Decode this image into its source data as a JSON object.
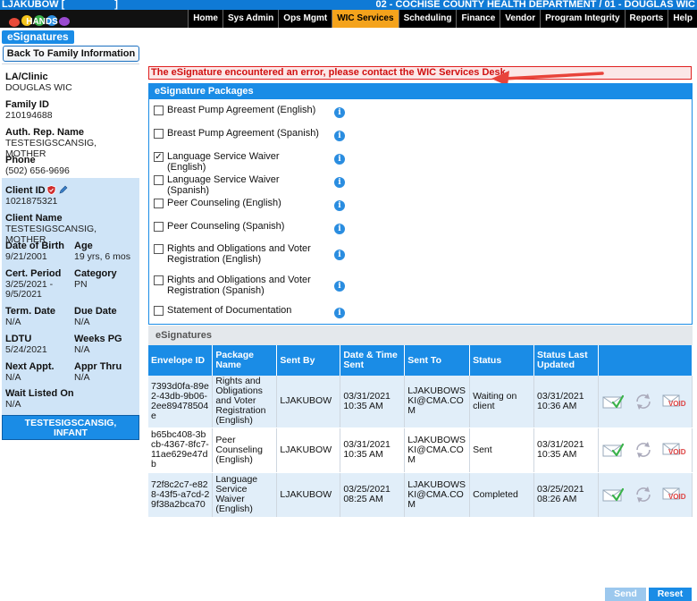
{
  "header": {
    "user": "LJAKUBOW [",
    "user_bracket_close": "]",
    "agency": "02 - COCHISE COUNTY HEALTH DEPARTMENT / 01 - DOUGLAS WIC",
    "logo_text": "HANDS"
  },
  "nav": {
    "tabs": [
      "Home",
      "Sys Admin",
      "Ops Mgmt",
      "WIC Services",
      "Scheduling",
      "Finance",
      "Vendor",
      "Program Integrity",
      "Reports",
      "Help"
    ],
    "active": "WIC Services"
  },
  "page": {
    "tag": "eSignatures",
    "back_button": "Back To Family Information"
  },
  "sidebar": {
    "la_clinic_label": "LA/Clinic",
    "la_clinic_value": "DOUGLAS WIC",
    "family_id_label": "Family ID",
    "family_id_value": "210194688",
    "auth_rep_label": "Auth. Rep. Name",
    "auth_rep_value": "TESTESIGSCANSIG, MOTHER",
    "phone_label": "Phone",
    "phone_value": "(502) 656-9696",
    "client_id_label": "Client ID",
    "client_id_value": "1021875321",
    "client_name_label": "Client Name",
    "client_name_value": "TESTESIGSCANSIG, MOTHER",
    "dob_label": "Date of Birth",
    "dob_value": "9/21/2001",
    "age_label": "Age",
    "age_value": "19 yrs, 6 mos",
    "cert_label": "Cert. Period",
    "cert_value1": "3/25/2021 -",
    "cert_value2": "9/5/2021",
    "category_label": "Category",
    "category_value": "PN",
    "term_label": "Term. Date",
    "term_value": "N/A",
    "due_label": "Due Date",
    "due_value": "N/A",
    "ldtu_label": "LDTU",
    "ldtu_value": "5/24/2021",
    "weeks_label": "Weeks PG",
    "weeks_value": "N/A",
    "next_appt_label": "Next Appt.",
    "next_appt_value": "N/A",
    "appr_label": "Appr Thru",
    "appr_value": "N/A",
    "wait_label": "Wait Listed On",
    "wait_value": "N/A",
    "infant_line1": "TESTESIGSCANSIG,",
    "infant_line2": "INFANT"
  },
  "error": "The eSignature encountered an error, please contact the WIC Services Desk.",
  "packages": {
    "title": "eSignature Packages",
    "items": [
      {
        "label": "Breast Pump Agreement (English)",
        "checked": false
      },
      {
        "label": "Breast Pump Agreement (Spanish)",
        "checked": false
      },
      {
        "label": "Language Service Waiver (English)",
        "checked": true
      },
      {
        "label": "Language Service Waiver (Spanish)",
        "checked": false
      },
      {
        "label": "Peer Counseling (English)",
        "checked": false
      },
      {
        "label": "Peer Counseling (Spanish)",
        "checked": false
      },
      {
        "label": "Rights and Obligations and Voter Registration (English)",
        "checked": false
      },
      {
        "label": "Rights and Obligations and Voter Registration (Spanish)",
        "checked": false
      },
      {
        "label": "Statement of Documentation",
        "checked": false
      }
    ]
  },
  "esignatures": {
    "title": "eSignatures",
    "columns": [
      "Envelope ID",
      "Package Name",
      "Sent By",
      "Date & Time Sent",
      "Sent To",
      "Status",
      "Status Last Updated"
    ],
    "rows": [
      {
        "envelope": "7393d0fa-89e2-43db-9b06-2ee89478504e",
        "package": "Rights and Obligations and Voter Registration (English)",
        "sent_by": "LJAKUBOW",
        "sent": "03/31/2021 10:35 AM",
        "sent_to": "LJAKUBOWSKI@CMA.COM",
        "status": "Waiting on client",
        "updated": "03/31/2021 10:36 AM"
      },
      {
        "envelope": "b65bc408-3bcb-4367-8fc7-11ae629e47db",
        "package": "Peer Counseling (English)",
        "sent_by": "LJAKUBOW",
        "sent": "03/31/2021 10:35 AM",
        "sent_to": "LJAKUBOWSKI@CMA.COM",
        "status": "Sent",
        "updated": "03/31/2021 10:35 AM"
      },
      {
        "envelope": "72f8c2c7-e828-43f5-a7cd-29f38a2bca70",
        "package": "Language Service Waiver (English)",
        "sent_by": "LJAKUBOW",
        "sent": "03/25/2021 08:25 AM",
        "sent_to": "LJAKUBOWSKI@CMA.COM",
        "status": "Completed",
        "updated": "03/25/2021 08:26 AM"
      }
    ],
    "void_label": "VOID"
  },
  "footer": {
    "send": "Send",
    "reset": "Reset"
  },
  "colors": {
    "primary": "#1a8ce6",
    "active_tab": "#f4a31c",
    "error": "#d01010"
  }
}
